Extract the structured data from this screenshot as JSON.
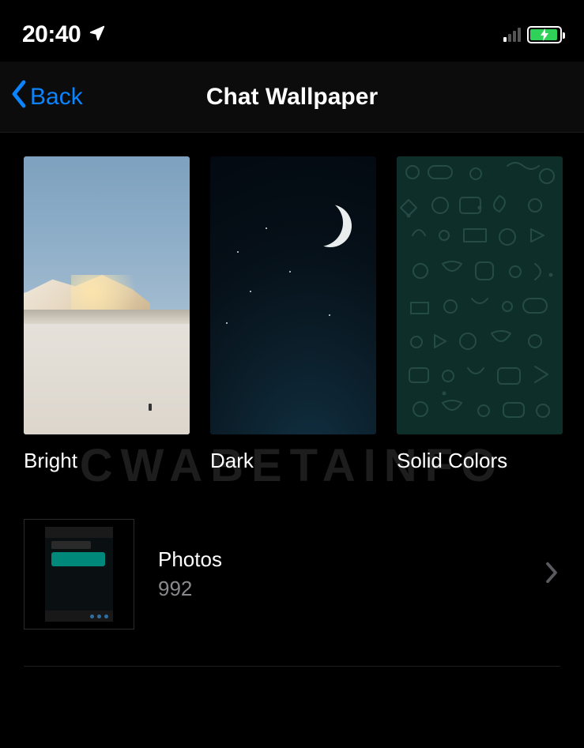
{
  "status": {
    "time": "20:40",
    "location_icon": "location-arrow",
    "signal_active_bars": 1,
    "battery_charging": true
  },
  "nav": {
    "back_label": "Back",
    "title": "Chat Wallpaper"
  },
  "categories": [
    {
      "key": "bright",
      "label": "Bright"
    },
    {
      "key": "dark",
      "label": "Dark"
    },
    {
      "key": "solid",
      "label": "Solid Colors"
    }
  ],
  "photos": {
    "title": "Photos",
    "count": "992"
  },
  "watermark": "CWABETAINFO",
  "colors": {
    "ios_blue": "#0a84ff",
    "battery_green": "#30d158",
    "wa_teal": "#0e2e2a",
    "wa_bubble": "#00897b"
  }
}
